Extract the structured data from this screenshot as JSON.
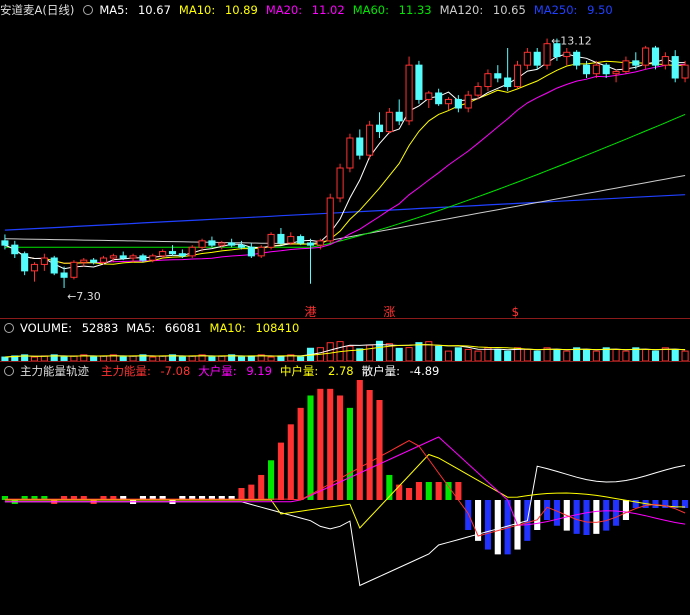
{
  "colors": {
    "up": "#ff3232",
    "down": "#54fcfc",
    "bg": "#000000",
    "ma5": "#ffffff",
    "ma10": "#ffff00",
    "ma20": "#ff00ff",
    "ma60": "#00e600",
    "ma120": "#cccccc",
    "ma250": "#2040ff"
  },
  "price_header": {
    "title": "安道麦A(日线)",
    "items": [
      {
        "label": "MA5:",
        "value": "10.67",
        "color": "#ffffff"
      },
      {
        "label": "MA10:",
        "value": "10.89",
        "color": "#ffff00"
      },
      {
        "label": "MA20:",
        "value": "11.02",
        "color": "#ff00ff"
      },
      {
        "label": "MA60:",
        "value": "11.33",
        "color": "#00e600"
      },
      {
        "label": "MA120:",
        "value": "10.65",
        "color": "#cccccc"
      },
      {
        "label": "MA250:",
        "value": "9.50",
        "color": "#2040ff"
      }
    ]
  },
  "volume_header": {
    "items": [
      {
        "label": "VOLUME:",
        "value": "52883",
        "color": "#ffffff"
      },
      {
        "label": "MA5:",
        "value": "66081",
        "color": "#ffffff"
      },
      {
        "label": "MA10:",
        "value": "108410",
        "color": "#ffff00"
      }
    ]
  },
  "indicator_header": {
    "title": "主力能量轨迹",
    "items": [
      {
        "label": "主力能量:",
        "value": "-7.08",
        "color": "#ff3232"
      },
      {
        "label": "大户量:",
        "value": "9.19",
        "color": "#ff00ff"
      },
      {
        "label": "中户量:",
        "value": "2.78",
        "color": "#ffff00"
      },
      {
        "label": "散户量:",
        "value": "-4.89",
        "color": "#ffffff"
      }
    ]
  },
  "chart_data": [
    {
      "type": "candlestick",
      "ylim": [
        6.6,
        13.6
      ],
      "annotations": {
        "high_label": "13.12",
        "low_label": "7.30"
      },
      "markers": [
        "港",
        "涨",
        "$"
      ],
      "ohlc": [
        [
          8.4,
          8.55,
          8.2,
          8.3
        ],
        [
          8.3,
          8.4,
          8.0,
          8.1
        ],
        [
          8.1,
          8.15,
          7.6,
          7.7
        ],
        [
          7.7,
          7.9,
          7.45,
          7.85
        ],
        [
          7.85,
          8.1,
          7.7,
          8.0
        ],
        [
          8.0,
          8.05,
          7.6,
          7.65
        ],
        [
          7.65,
          7.8,
          7.3,
          7.55
        ],
        [
          7.55,
          7.95,
          7.5,
          7.9
        ],
        [
          7.9,
          8.0,
          7.8,
          7.95
        ],
        [
          7.95,
          8.0,
          7.85,
          7.9
        ],
        [
          7.9,
          8.05,
          7.85,
          8.0
        ],
        [
          8.0,
          8.1,
          7.9,
          8.05
        ],
        [
          8.05,
          8.15,
          7.95,
          8.0
        ],
        [
          8.0,
          8.1,
          7.9,
          8.05
        ],
        [
          8.05,
          8.1,
          7.9,
          7.95
        ],
        [
          7.95,
          8.1,
          7.9,
          8.05
        ],
        [
          8.05,
          8.2,
          8.0,
          8.15
        ],
        [
          8.15,
          8.3,
          8.05,
          8.1
        ],
        [
          8.1,
          8.2,
          8.0,
          8.05
        ],
        [
          8.05,
          8.3,
          8.0,
          8.25
        ],
        [
          8.25,
          8.45,
          8.15,
          8.4
        ],
        [
          8.4,
          8.5,
          8.25,
          8.3
        ],
        [
          8.3,
          8.4,
          8.2,
          8.35
        ],
        [
          8.35,
          8.45,
          8.25,
          8.3
        ],
        [
          8.3,
          8.4,
          8.2,
          8.25
        ],
        [
          8.25,
          8.35,
          8.0,
          8.05
        ],
        [
          8.05,
          8.3,
          8.0,
          8.25
        ],
        [
          8.25,
          8.6,
          8.2,
          8.55
        ],
        [
          8.55,
          8.7,
          8.3,
          8.35
        ],
        [
          8.35,
          8.6,
          8.3,
          8.5
        ],
        [
          8.5,
          8.55,
          8.3,
          8.35
        ],
        [
          8.35,
          8.45,
          7.4,
          8.3
        ],
        [
          8.3,
          8.45,
          8.2,
          8.4
        ],
        [
          8.4,
          9.5,
          8.35,
          9.4
        ],
        [
          9.4,
          10.2,
          9.3,
          10.1
        ],
        [
          10.1,
          10.9,
          10.0,
          10.8
        ],
        [
          10.8,
          11.0,
          10.3,
          10.4
        ],
        [
          10.4,
          11.2,
          10.3,
          11.1
        ],
        [
          11.1,
          11.4,
          10.8,
          10.95
        ],
        [
          10.95,
          11.5,
          10.9,
          11.4
        ],
        [
          11.4,
          11.7,
          11.1,
          11.2
        ],
        [
          11.2,
          12.7,
          11.1,
          12.5
        ],
        [
          12.5,
          12.6,
          11.6,
          11.7
        ],
        [
          11.7,
          11.9,
          11.5,
          11.85
        ],
        [
          11.85,
          11.95,
          11.55,
          11.6
        ],
        [
          11.6,
          11.75,
          11.45,
          11.7
        ],
        [
          11.7,
          11.8,
          11.4,
          11.5
        ],
        [
          11.5,
          11.9,
          11.4,
          11.8
        ],
        [
          11.8,
          12.1,
          11.7,
          12.0
        ],
        [
          12.0,
          12.4,
          11.9,
          12.3
        ],
        [
          12.3,
          12.5,
          12.1,
          12.2
        ],
        [
          12.2,
          12.9,
          11.9,
          12.0
        ],
        [
          12.0,
          12.6,
          11.95,
          12.5
        ],
        [
          12.5,
          12.9,
          12.4,
          12.8
        ],
        [
          12.8,
          12.9,
          12.4,
          12.5
        ],
        [
          12.5,
          13.12,
          12.4,
          13.0
        ],
        [
          13.0,
          13.12,
          12.6,
          12.7
        ],
        [
          12.7,
          12.9,
          12.5,
          12.8
        ],
        [
          12.8,
          12.85,
          12.4,
          12.5
        ],
        [
          12.5,
          12.6,
          12.2,
          12.3
        ],
        [
          12.3,
          12.6,
          12.2,
          12.5
        ],
        [
          12.5,
          12.55,
          12.2,
          12.3
        ],
        [
          12.3,
          12.4,
          12.1,
          12.35
        ],
        [
          12.35,
          12.7,
          12.3,
          12.6
        ],
        [
          12.6,
          12.8,
          12.4,
          12.5
        ],
        [
          12.5,
          12.95,
          12.4,
          12.9
        ],
        [
          12.9,
          12.95,
          12.4,
          12.5
        ],
        [
          12.5,
          12.8,
          12.4,
          12.7
        ],
        [
          12.7,
          12.85,
          12.1,
          12.2
        ],
        [
          12.2,
          12.6,
          12.1,
          12.5
        ]
      ]
    },
    {
      "type": "bar",
      "name": "VOLUME"
    },
    {
      "type": "bar",
      "name": "主力能量轨迹"
    }
  ]
}
